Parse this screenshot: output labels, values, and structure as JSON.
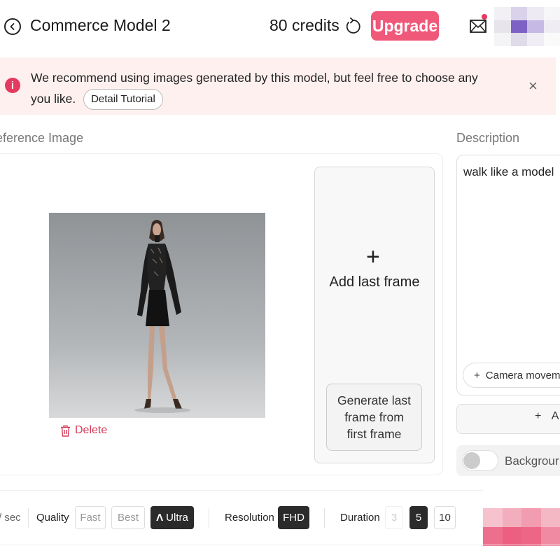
{
  "header": {
    "title": "Commerce Model 2",
    "credits": "80 credits",
    "upgrade_label": "Upgrade"
  },
  "notice": {
    "message": "We recommend using images generated by this model, but feel free to choose any you like.",
    "tutorial_label": "Detail Tutorial",
    "close_glyph": "×"
  },
  "reference": {
    "label": "eference Image",
    "delete_label": "Delete",
    "add_last_frame_label": "Add last frame",
    "generate_last_frame_label": "Generate last frame from first frame"
  },
  "description": {
    "label": "Description",
    "text": "walk like a model",
    "camera_movement_label": "Camera moveme",
    "add_label": "A",
    "background_label": "Backgrour"
  },
  "bottom_bar": {
    "fps_label": "/ sec",
    "quality_label": "Quality",
    "quality_options": [
      "Fast",
      "Best",
      "Ultra"
    ],
    "quality_selected": "Ultra",
    "resolution_label": "Resolution",
    "resolution_value": "FHD",
    "duration_label": "Duration",
    "duration_options": [
      "3",
      "5",
      "10"
    ],
    "duration_selected": "5"
  },
  "colors": {
    "accent": "#f0587a",
    "danger": "#e5395f",
    "banner_bg": "#fdf0ef",
    "active_option": "#2b2b2b"
  },
  "icons": {
    "back": "back-arrow-icon",
    "refresh": "refresh-icon",
    "mail": "mail-icon",
    "info": "info-icon",
    "close": "close-icon",
    "trash": "trash-icon",
    "plus": "plus-icon"
  }
}
